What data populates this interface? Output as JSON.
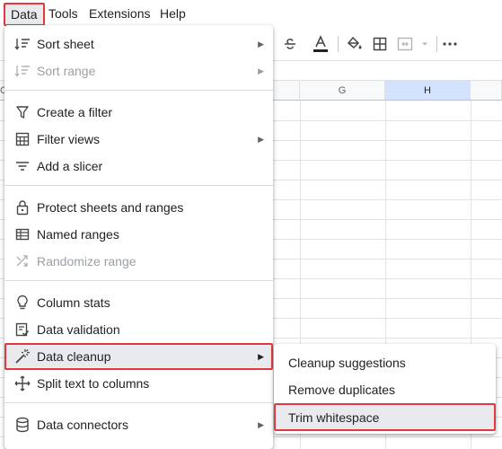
{
  "menubar": {
    "items": [
      "Data",
      "Tools",
      "Extensions",
      "Help"
    ]
  },
  "grid": {
    "columns": [
      "G",
      "H"
    ],
    "row_head_partial": "C"
  },
  "data_menu": {
    "items": [
      {
        "label": "Sort sheet",
        "icon": "sort-icon",
        "submenu": true,
        "disabled": false
      },
      {
        "label": "Sort range",
        "icon": "sort-icon",
        "submenu": true,
        "disabled": true
      },
      {
        "label": "Create a filter",
        "icon": "filter-icon",
        "submenu": false,
        "disabled": false
      },
      {
        "label": "Filter views",
        "icon": "filter-views-icon",
        "submenu": true,
        "disabled": false
      },
      {
        "label": "Add a slicer",
        "icon": "slicer-icon",
        "submenu": false,
        "disabled": false
      },
      {
        "label": "Protect sheets and ranges",
        "icon": "lock-icon",
        "submenu": false,
        "disabled": false
      },
      {
        "label": "Named ranges",
        "icon": "named-ranges-icon",
        "submenu": false,
        "disabled": false
      },
      {
        "label": "Randomize range",
        "icon": "shuffle-icon",
        "submenu": false,
        "disabled": true
      },
      {
        "label": "Column stats",
        "icon": "lightbulb-icon",
        "submenu": false,
        "disabled": false
      },
      {
        "label": "Data validation",
        "icon": "validation-icon",
        "submenu": false,
        "disabled": false
      },
      {
        "label": "Data cleanup",
        "icon": "magic-wand-icon",
        "submenu": true,
        "disabled": false,
        "highlighted": true
      },
      {
        "label": "Split text to columns",
        "icon": "split-columns-icon",
        "submenu": false,
        "disabled": false
      },
      {
        "label": "Data connectors",
        "icon": "database-icon",
        "submenu": true,
        "disabled": false
      }
    ]
  },
  "cleanup_submenu": {
    "items": [
      {
        "label": "Cleanup suggestions"
      },
      {
        "label": "Remove duplicates"
      },
      {
        "label": "Trim whitespace",
        "highlighted": true
      }
    ]
  },
  "colors": {
    "highlight_border": "#e2383f",
    "highlight_bg": "#e8eaed",
    "disabled_text": "#9aa0a6",
    "selected_column": "#d3e3fd"
  }
}
